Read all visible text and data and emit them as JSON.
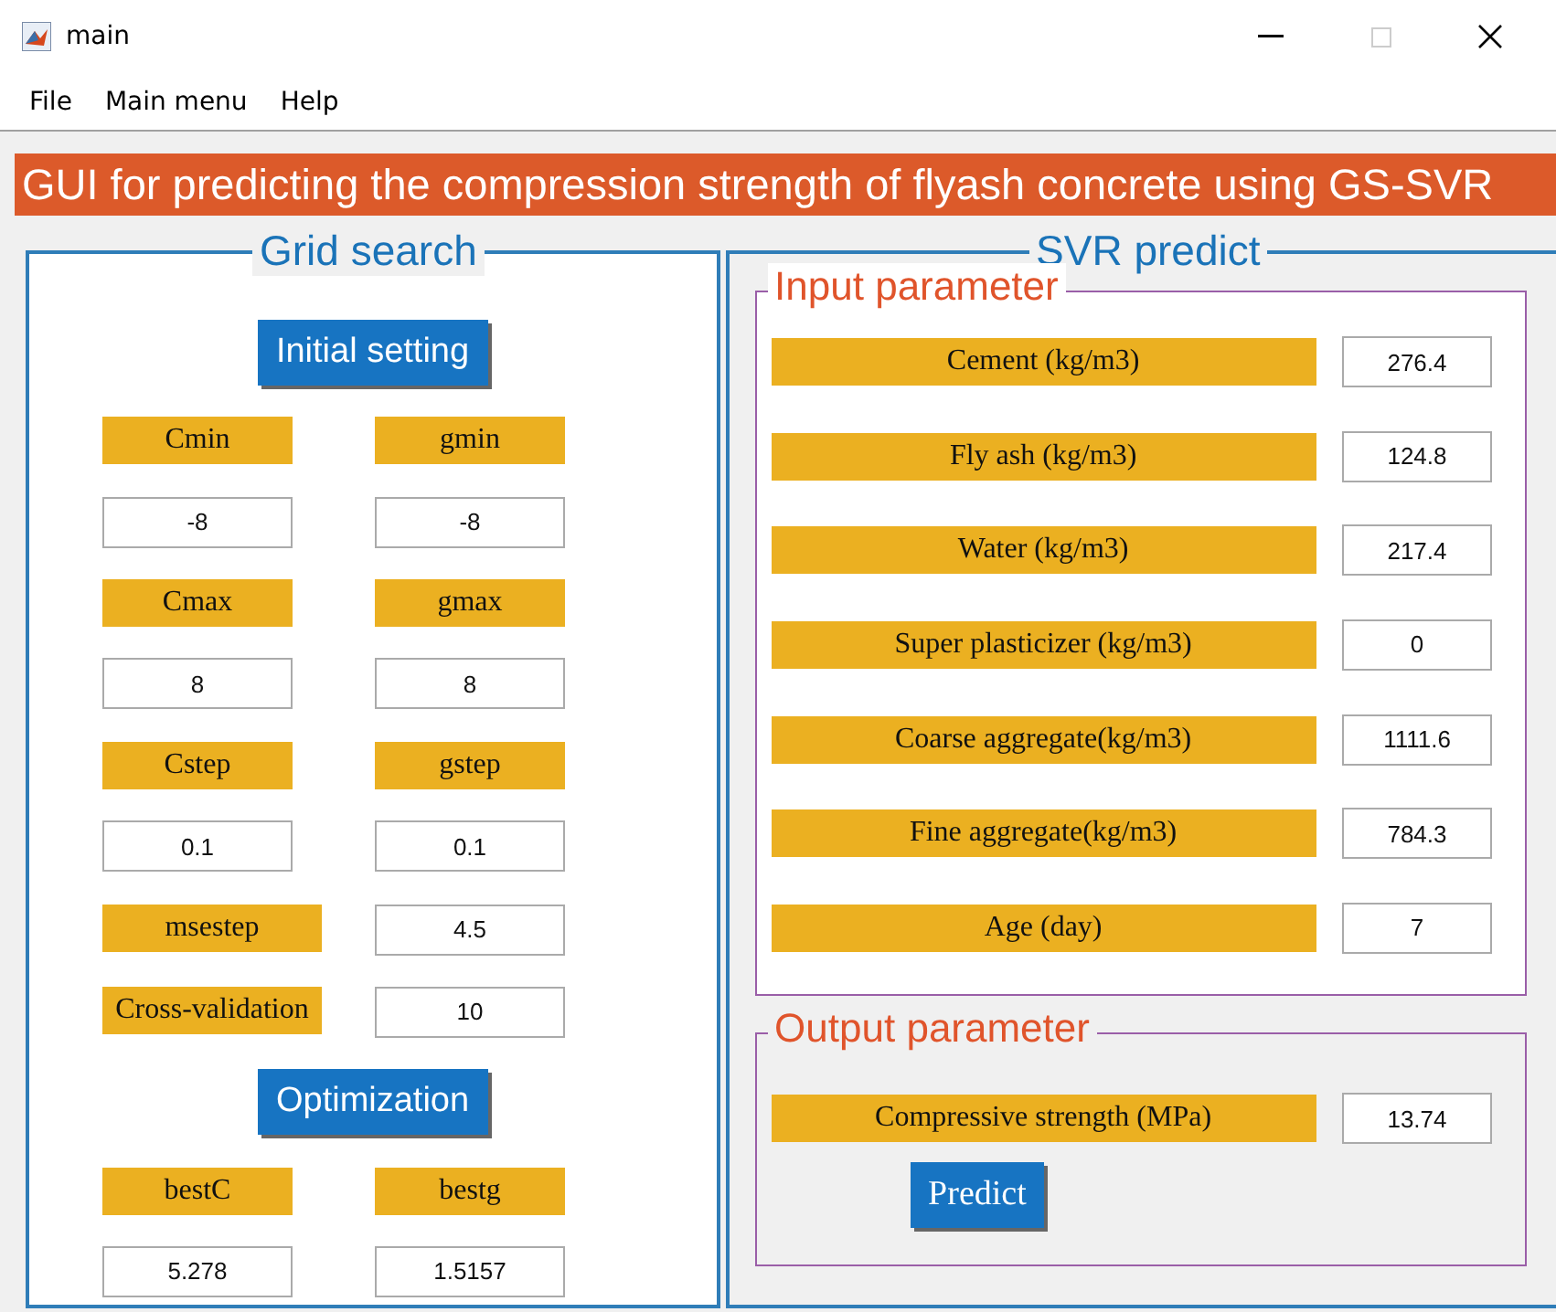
{
  "window": {
    "title": "main"
  },
  "menu": [
    "File",
    "Main menu",
    "Help"
  ],
  "banner": "GUI for predicting the compression strength of flyash concrete using GS-SVR",
  "grid_search": {
    "title": "Grid search",
    "rows": [
      {
        "kind": "button",
        "label": "Initial setting"
      },
      {
        "kind": "labels",
        "items": [
          "Cmin",
          "gmin"
        ]
      },
      {
        "kind": "fields",
        "items": [
          "-8",
          "-8"
        ]
      },
      {
        "kind": "labels",
        "items": [
          "Cmax",
          "gmax"
        ]
      },
      {
        "kind": "fields",
        "items": [
          "8",
          "8"
        ]
      },
      {
        "kind": "labels",
        "items": [
          "Cstep",
          "gstep"
        ]
      },
      {
        "kind": "fields",
        "items": [
          "0.1",
          "0.1"
        ]
      },
      {
        "kind": "label-field",
        "items": [
          "msestep",
          "4.5"
        ]
      },
      {
        "kind": "label-field",
        "items": [
          "Cross-validation",
          "10"
        ]
      },
      {
        "kind": "button",
        "label": "Optimization"
      },
      {
        "kind": "labels",
        "items": [
          "bestC",
          "bestg"
        ]
      },
      {
        "kind": "fields",
        "items": [
          "5.278",
          "1.5157"
        ]
      }
    ]
  },
  "svr_predict": {
    "title": "SVR predict",
    "input": {
      "title": "Input parameter",
      "rows": [
        {
          "label": "Cement (kg/m3)",
          "value": "276.4"
        },
        {
          "label": "Fly ash (kg/m3)",
          "value": "124.8"
        },
        {
          "label": "Water (kg/m3)",
          "value": "217.4"
        },
        {
          "label": "Super plasticizer  (kg/m3)",
          "value": "0"
        },
        {
          "label": "Coarse aggregate(kg/m3)",
          "value": "1111.6"
        },
        {
          "label": "Fine aggregate(kg/m3)",
          "value": "784.3"
        },
        {
          "label": "Age (day)",
          "value": "7"
        }
      ]
    },
    "output": {
      "title": "Output parameter",
      "rows": [
        {
          "label": "Compressive strength (MPa)",
          "value": "13.74"
        }
      ],
      "button": "Predict"
    }
  }
}
